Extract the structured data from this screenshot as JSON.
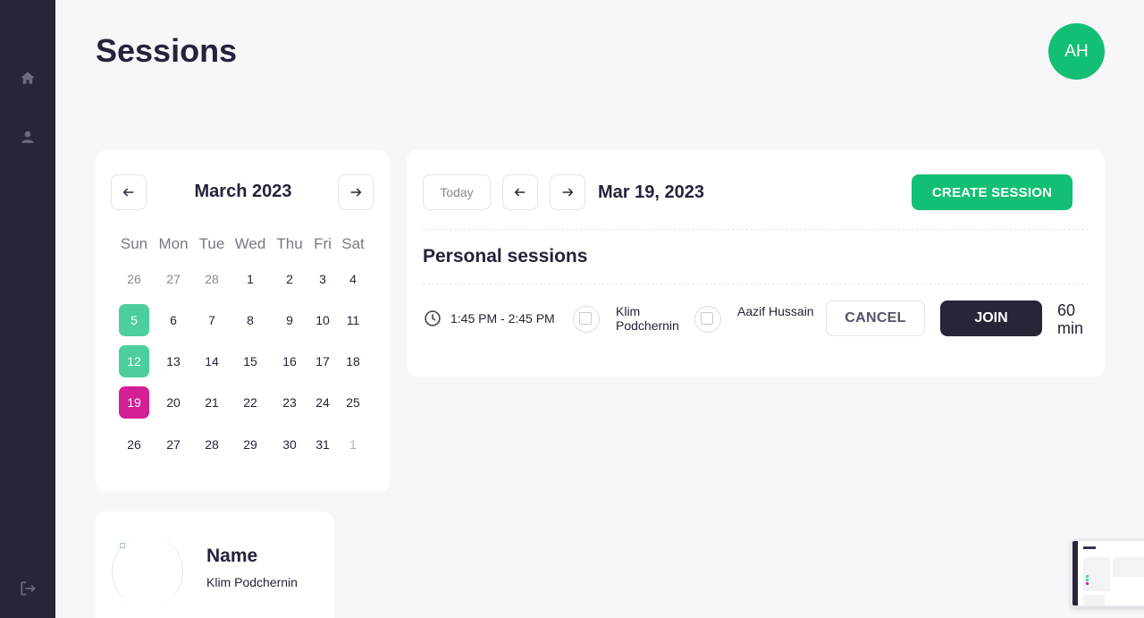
{
  "header": {
    "title": "Sessions",
    "avatar_initials": "AH"
  },
  "sidebar": {
    "items": [
      {
        "icon": "home-icon"
      },
      {
        "icon": "user-icon"
      },
      {
        "icon": "logout-icon"
      }
    ]
  },
  "calendar": {
    "month_label": "March 2023",
    "weekdays": [
      "Sun",
      "Mon",
      "Tue",
      "Wed",
      "Thu",
      "Fri",
      "Sat"
    ],
    "weeks": [
      [
        "26",
        "27",
        "28",
        "1",
        "2",
        "3",
        "4"
      ],
      [
        "5",
        "6",
        "7",
        "8",
        "9",
        "10",
        "11"
      ],
      [
        "12",
        "13",
        "14",
        "15",
        "16",
        "17",
        "18"
      ],
      [
        "19",
        "20",
        "21",
        "22",
        "23",
        "24",
        "25"
      ],
      [
        "26",
        "27",
        "28",
        "29",
        "30",
        "31",
        "1"
      ]
    ],
    "highlighted_green": [
      "5",
      "12"
    ],
    "selected": "19",
    "colors": {
      "green": "#4ccf9c",
      "selected": "#d41f95"
    }
  },
  "sessions": {
    "today_label": "Today",
    "date_label": "Mar 19, 2023",
    "create_label": "CREATE SESSION",
    "section_title": "Personal sessions",
    "items": [
      {
        "time": "1:45 PM - 2:45 PM",
        "participant_1": "Klim Podchernin",
        "participant_2": "Aazif Hussain",
        "cancel_label": "CANCEL",
        "join_label": "JOIN",
        "duration": "60 min"
      }
    ]
  },
  "profile": {
    "label": "Name",
    "name": "Klim Podchernin"
  },
  "colors": {
    "sidebar": "#2a2438",
    "accent_green": "#13bf74",
    "dark_button": "#2a2438"
  }
}
